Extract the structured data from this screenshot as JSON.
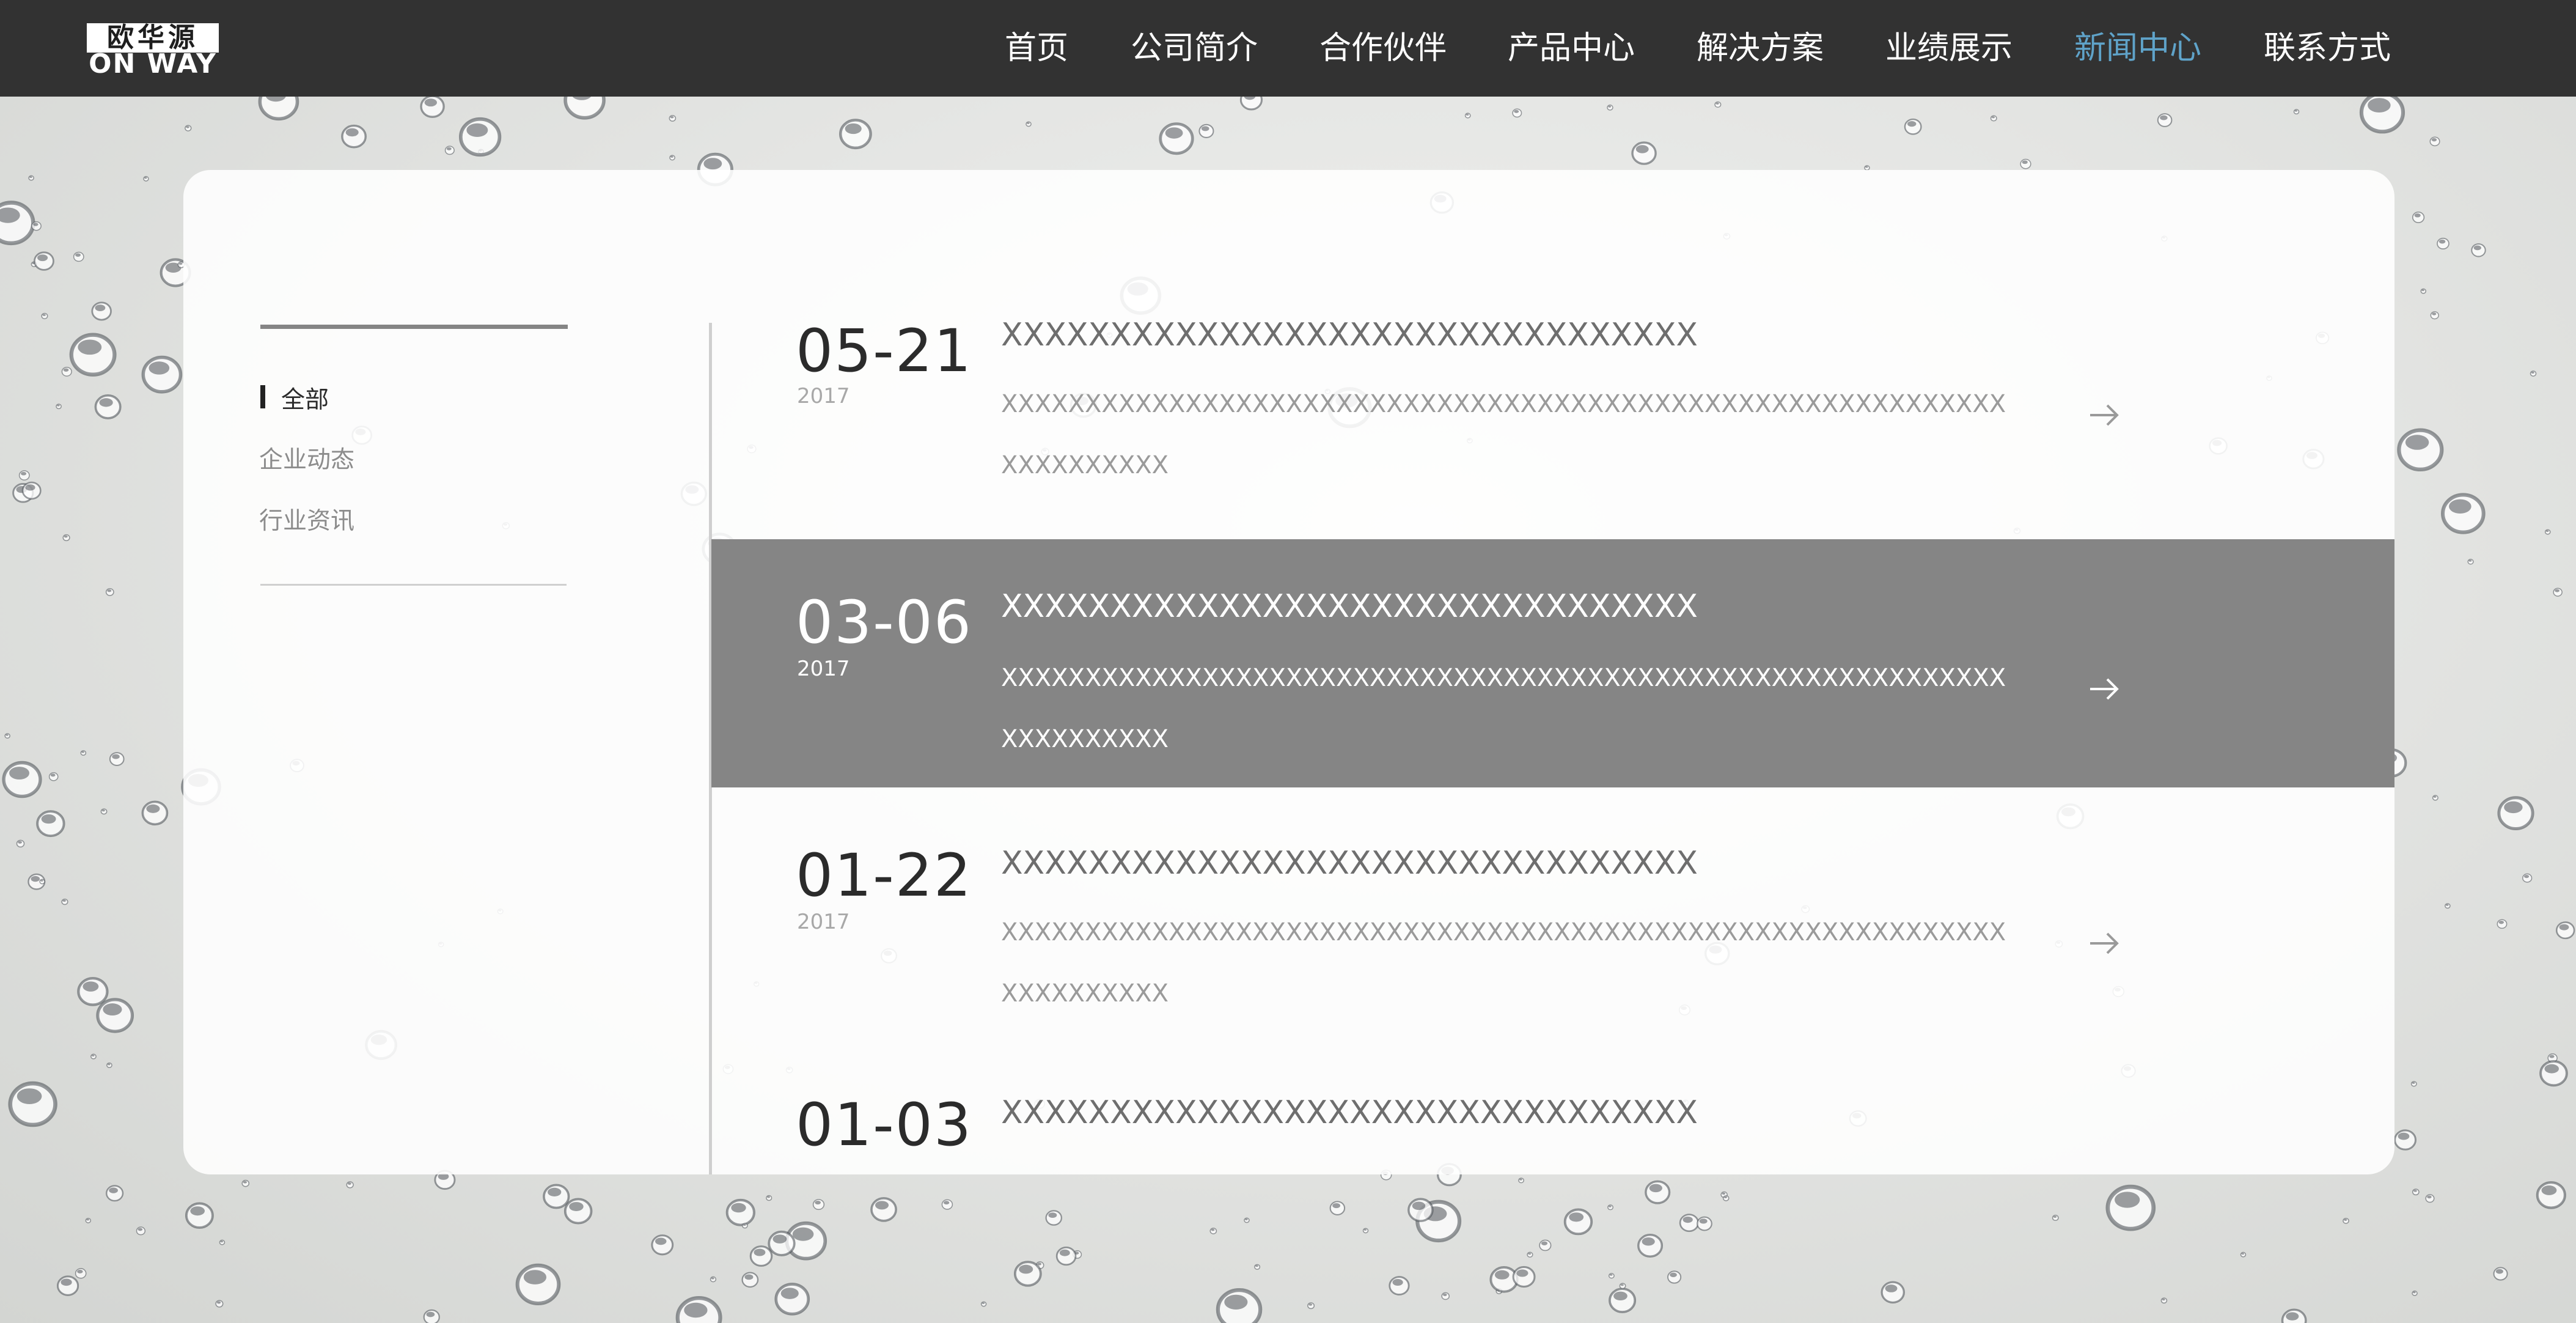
{
  "logo": {
    "cn": "欧华源",
    "en": "ON WAY"
  },
  "nav": [
    {
      "label": "首页",
      "active": false
    },
    {
      "label": "公司简介",
      "active": false
    },
    {
      "label": "合作伙伴",
      "active": false
    },
    {
      "label": "产品中心",
      "active": false
    },
    {
      "label": "解决方案",
      "active": false
    },
    {
      "label": "业绩展示",
      "active": false
    },
    {
      "label": "新闻中心",
      "active": true
    },
    {
      "label": "联系方式",
      "active": false
    }
  ],
  "sidebar": {
    "categories": [
      {
        "label": "全部",
        "active": true
      },
      {
        "label": "企业动态",
        "active": false
      },
      {
        "label": "行业资讯",
        "active": false
      }
    ]
  },
  "news": [
    {
      "date": "05-21",
      "year": "2017",
      "title": "XXXXXXXXXXXXXXXXXXXXXXXXXXXXXXXX",
      "desc_line1": "XXXXXXXXXXXXXXXXXXXXXXXXXXXXXXXXXXXXXXXXXXXXXXXXXXXXXXXXXXXX",
      "desc_line2": "XXXXXXXXXX",
      "highlighted": false
    },
    {
      "date": "03-06",
      "year": "2017",
      "title": "XXXXXXXXXXXXXXXXXXXXXXXXXXXXXXXX",
      "desc_line1": "XXXXXXXXXXXXXXXXXXXXXXXXXXXXXXXXXXXXXXXXXXXXXXXXXXXXXXXXXXXX",
      "desc_line2": "XXXXXXXXXX",
      "highlighted": true
    },
    {
      "date": "01-22",
      "year": "2017",
      "title": "XXXXXXXXXXXXXXXXXXXXXXXXXXXXXXXX",
      "desc_line1": "XXXXXXXXXXXXXXXXXXXXXXXXXXXXXXXXXXXXXXXXXXXXXXXXXXXXXXXXXXXX",
      "desc_line2": "XXXXXXXXXX",
      "highlighted": false
    },
    {
      "date": "01-03",
      "title": "XXXXXXXXXXXXXXXXXXXXXXXXXXXXXXXX",
      "highlighted": false
    }
  ],
  "colors": {
    "header_bg": "#323232",
    "nav_active": "#5fa3c9",
    "highlight_row": "#858585"
  },
  "icons": {
    "row_arrow": "arrow-right-icon"
  }
}
